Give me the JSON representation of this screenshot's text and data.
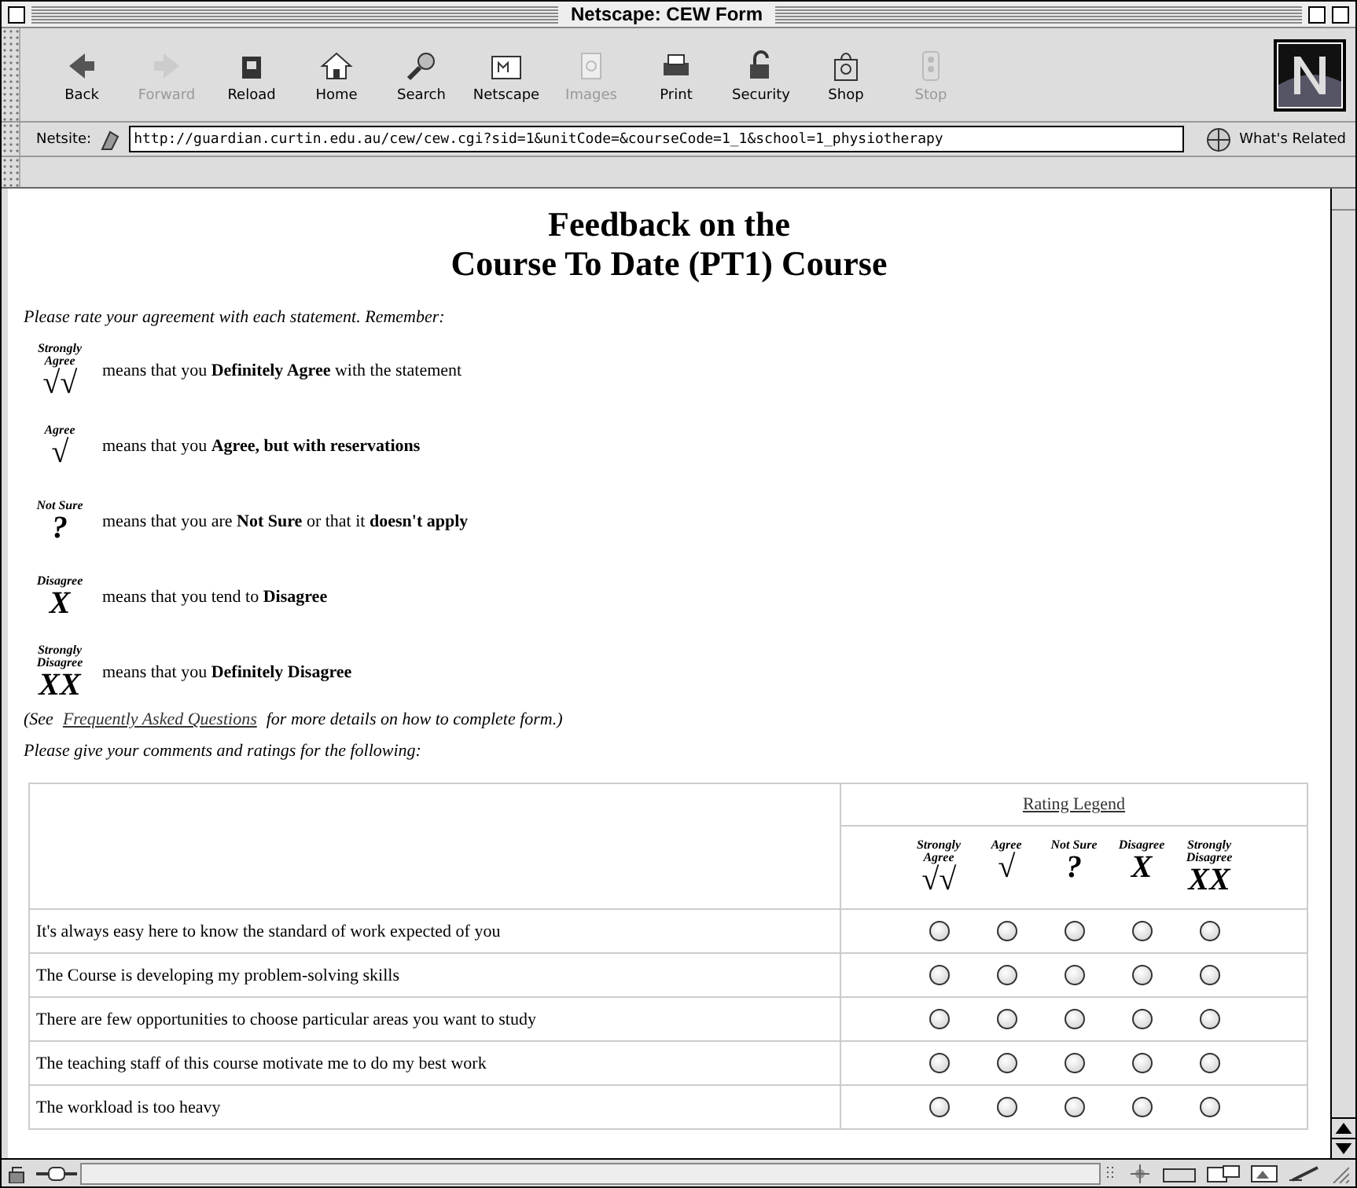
{
  "window": {
    "title": "Netscape: CEW Form"
  },
  "toolbar": [
    {
      "label": "Back",
      "disabled": false
    },
    {
      "label": "Forward",
      "disabled": true
    },
    {
      "label": "Reload",
      "disabled": false
    },
    {
      "label": "Home",
      "disabled": false
    },
    {
      "label": "Search",
      "disabled": false
    },
    {
      "label": "Netscape",
      "disabled": false
    },
    {
      "label": "Images",
      "disabled": true
    },
    {
      "label": "Print",
      "disabled": false
    },
    {
      "label": "Security",
      "disabled": false
    },
    {
      "label": "Shop",
      "disabled": false
    },
    {
      "label": "Stop",
      "disabled": true
    }
  ],
  "location_bar": {
    "label": "Netsite:",
    "url": "http://guardian.curtin.edu.au/cew/cew.cgi?sid=1&unitCode=&courseCode=1_1&school=1_physiotherapy",
    "related": "What's Related"
  },
  "page": {
    "heading": [
      "Feedback on the",
      "Course To Date (PT1) Course"
    ],
    "intro": "Please rate your agreement with each statement. Remember:",
    "legend": [
      {
        "label": "Strongly Agree",
        "symbol": "√√",
        "text": "means that you **Definitely Agree** with the statement"
      },
      {
        "label": "Agree",
        "symbol": "√",
        "text": "means that you **Agree, but with reservations**"
      },
      {
        "label": "Not Sure",
        "symbol": "?",
        "text": "means that you are **Not Sure** or that it **doesn't apply**"
      },
      {
        "label": "Disagree",
        "symbol": "X",
        "text": "means that you tend to **Disagree**"
      },
      {
        "label": "Strongly Disagree",
        "symbol": "XX",
        "text": "means that you **Definitely Disagree**"
      }
    ],
    "faq": {
      "before": "(See",
      "link": "Frequently Asked Questions",
      "after": "for more details on how to complete form.)"
    },
    "comments_prompt": "Please give your comments and ratings for the following:",
    "table": {
      "legend_link": "Rating Legend",
      "columns": [
        {
          "label": "Strongly Agree",
          "symbol": "√√"
        },
        {
          "label": "Agree",
          "symbol": "√"
        },
        {
          "label": "Not Sure",
          "symbol": "?"
        },
        {
          "label": "Disagree",
          "symbol": "X"
        },
        {
          "label": "Strongly Disagree",
          "symbol": "XX"
        }
      ],
      "rows": [
        {
          "statement": "It's always easy here to know the standard of work expected of you",
          "ratings": [
            {
              "selected": false
            },
            {
              "selected": false
            },
            {
              "selected": false
            },
            {
              "selected": false
            },
            {
              "selected": false
            }
          ]
        },
        {
          "statement": "The Course is developing my problem-solving skills",
          "ratings": [
            {
              "selected": false
            },
            {
              "selected": false
            },
            {
              "selected": false
            },
            {
              "selected": false
            },
            {
              "selected": false
            }
          ]
        },
        {
          "statement": "There are few opportunities to choose particular areas you want to study",
          "ratings": [
            {
              "selected": false
            },
            {
              "selected": false
            },
            {
              "selected": false
            },
            {
              "selected": false
            },
            {
              "selected": false
            }
          ]
        },
        {
          "statement": "The teaching staff of this course motivate me to do my best work",
          "ratings": [
            {
              "selected": false
            },
            {
              "selected": false
            },
            {
              "selected": false
            },
            {
              "selected": false
            },
            {
              "selected": false
            }
          ]
        },
        {
          "statement": "The workload is too heavy",
          "ratings": [
            {
              "selected": false
            },
            {
              "selected": false
            },
            {
              "selected": false
            },
            {
              "selected": false
            },
            {
              "selected": false
            }
          ]
        }
      ]
    }
  }
}
